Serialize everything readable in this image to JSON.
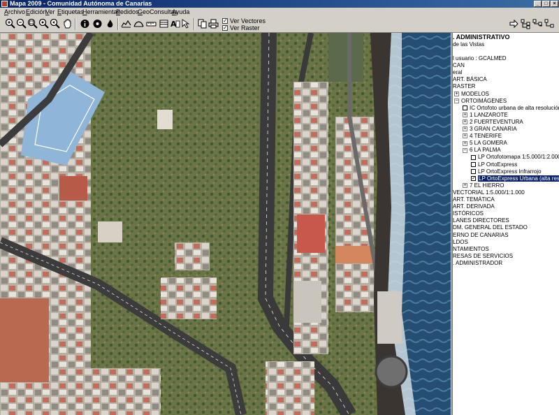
{
  "window": {
    "title": "Mapa  2009  -  Comunidad Autónoma de Canarias"
  },
  "menu": [
    {
      "label": "Archivo"
    },
    {
      "label": "Edición"
    },
    {
      "label": "Ver"
    },
    {
      "label": "Etiquetas"
    },
    {
      "label": "Herramientas"
    },
    {
      "label": "Pedidos"
    },
    {
      "label": "GeoConsultas"
    },
    {
      "label": "Ayuda"
    }
  ],
  "toolbar": {
    "ver_vectores": {
      "label": "Ver Vectores",
      "checked": "✓"
    },
    "ver_raster": {
      "label": "Ver Raster",
      "checked": "✓"
    }
  },
  "panel": {
    "title": ". ADMINISTRATIVO",
    "subtitle": "de las Vistas",
    "tree": [
      {
        "label": "l usuario : GCALMED",
        "x": 0
      },
      {
        "label": "CAN",
        "x": 0
      },
      {
        "label": "eral",
        "x": 0
      },
      {
        "label": "ART. BÁSICA",
        "x": 0
      },
      {
        "label": "RASTER",
        "x": 0
      },
      {
        "label": "MODELOS",
        "x": 2,
        "exp": "+"
      },
      {
        "label": "ORTOIMÁGENES",
        "x": 2,
        "exp": "−"
      },
      {
        "label": "IC Ortofoto urbana de alta resolución (Servi",
        "x": 14,
        "cb": " "
      },
      {
        "label": "1 LANZAROTE",
        "x": 14,
        "exp": "+"
      },
      {
        "label": "2 FUERTEVENTURA",
        "x": 14,
        "exp": "+"
      },
      {
        "label": "3 GRAN CANARIA",
        "x": 14,
        "exp": "+"
      },
      {
        "label": "4 TENERIFE",
        "x": 14,
        "exp": "+"
      },
      {
        "label": "5 LA GOMERA",
        "x": 14,
        "exp": "+"
      },
      {
        "label": "6 LA PALMA",
        "x": 14,
        "exp": "−"
      },
      {
        "label": "LP Ortofotomapa 1:5.000/1:2.000",
        "x": 26,
        "cb": " "
      },
      {
        "label": "LP OrtoExpress",
        "x": 26,
        "cb": " "
      },
      {
        "label": "LP OrtoExpress Infrarrojo",
        "x": 26,
        "cb": " "
      },
      {
        "label": "LP OrtoExpress Urbana (alta resolución",
        "x": 26,
        "cb": "✓",
        "selected": true
      },
      {
        "label": "7 EL HIERRO",
        "x": 14,
        "exp": "+"
      },
      {
        "label": "VECTORIAL 1:5.000/1:1.000",
        "x": 0
      },
      {
        "label": "ART. TEMÁTICA",
        "x": 0
      },
      {
        "label": "ART. DERIVADA",
        "x": 0
      },
      {
        "label": "ISTÓRICOS",
        "x": 0
      },
      {
        "label": "LANES DIRECTORES",
        "x": 0
      },
      {
        "label": "DM. GENERAL DEL ESTADO",
        "x": 0
      },
      {
        "label": "ERNO DE CANARIAS",
        "x": 0
      },
      {
        "label": "LDOS",
        "x": 0
      },
      {
        "label": "NTAMIENTOS",
        "x": 0
      },
      {
        "label": "RESAS DE SERVICIOS",
        "x": 0
      },
      {
        "label": ". ADMINISTRADOR",
        "x": 0
      }
    ]
  },
  "icons": [
    "zoom-in-icon",
    "zoom-out-icon",
    "zoom-window-icon",
    "zoom-extent-icon",
    "zoom-previous-icon",
    "pan-hand-icon",
    "info-icon",
    "locate-icon",
    "fire-icon",
    "profile-icon",
    "area-measure-icon",
    "ruler-icon",
    "sheet-icon",
    "label-icon",
    "pointer-icon",
    "copy-icon",
    "print-icon",
    "forward-arrow-icon",
    "tree-icon"
  ]
}
